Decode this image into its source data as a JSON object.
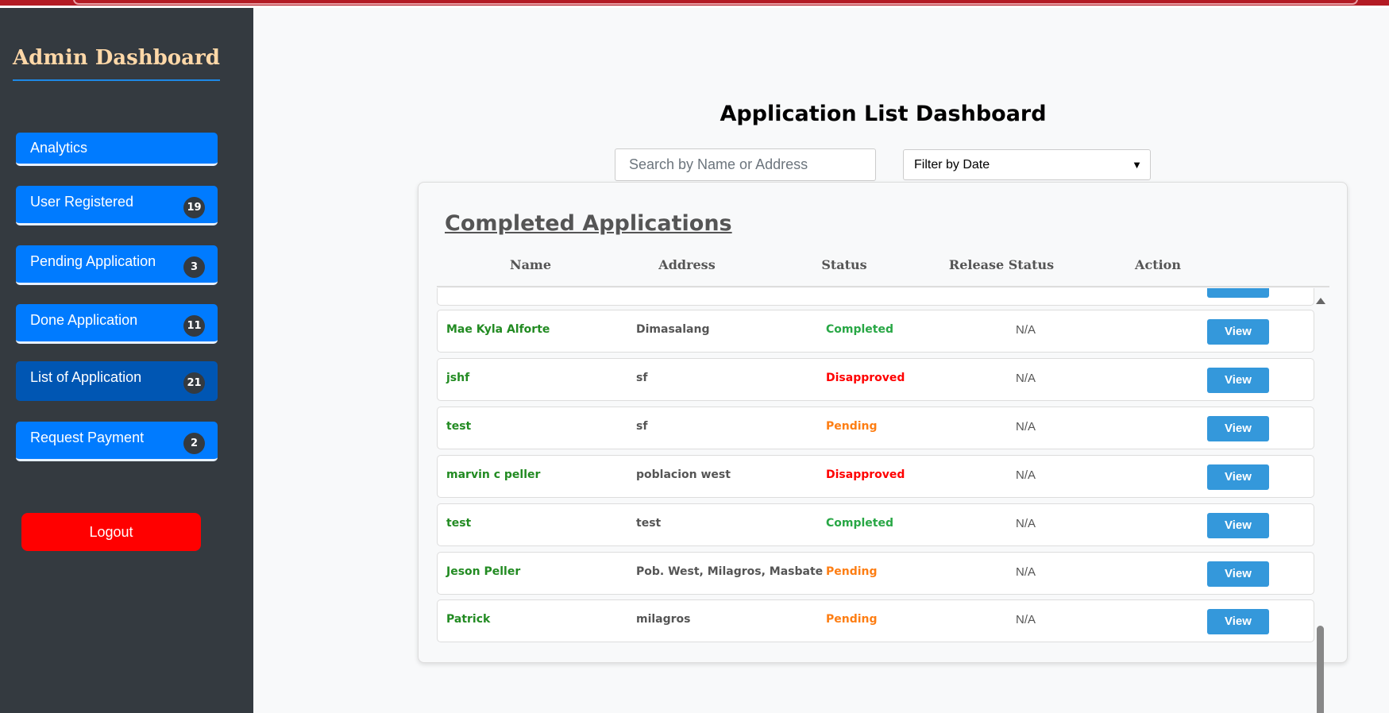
{
  "sidebar": {
    "brand": "Admin Dashboard",
    "items": [
      {
        "label": "Analytics",
        "badge": null
      },
      {
        "label": "User Registered",
        "badge": "19"
      },
      {
        "label": "Pending Application",
        "badge": "3"
      },
      {
        "label": "Done Application",
        "badge": "11"
      },
      {
        "label": "List of Application",
        "badge": "21"
      },
      {
        "label": "Request Payment",
        "badge": "2"
      }
    ],
    "logout_label": "Logout"
  },
  "main": {
    "title": "Application List Dashboard",
    "search_placeholder": "Search by Name or Address",
    "filter_selected": "Filter by Date",
    "card_title": "Completed Applications",
    "columns": [
      "Name",
      "Address",
      "Status",
      "Release Status",
      "Action"
    ],
    "rows": [
      {
        "name": "Mae Kyla Alforte",
        "address": "Dimasalang",
        "status": "Completed",
        "release": "N/A",
        "action": "View"
      },
      {
        "name": "jshf",
        "address": "sf",
        "status": "Disapproved",
        "release": "N/A",
        "action": "View"
      },
      {
        "name": "test",
        "address": "sf",
        "status": "Pending",
        "release": "N/A",
        "action": "View"
      },
      {
        "name": "marvin c peller",
        "address": "poblacion west",
        "status": "Disapproved",
        "release": "N/A",
        "action": "View"
      },
      {
        "name": "test",
        "address": "test",
        "status": "Completed",
        "release": "N/A",
        "action": "View"
      },
      {
        "name": "Jeson Peller",
        "address": "Pob. West, Milagros, Masbate",
        "status": "Pending",
        "release": "N/A",
        "action": "View"
      },
      {
        "name": "Patrick",
        "address": "milagros",
        "status": "Pending",
        "release": "N/A",
        "action": "View"
      }
    ]
  },
  "colors": {
    "sidebar_bg": "#343a40",
    "nav_blue": "#007bff",
    "nav_active": "#0056b3",
    "logout_red": "#ff0000",
    "view_button": "#3498db",
    "completed": "#28a745",
    "disapproved": "#ff0000",
    "pending": "#fd7e14",
    "name_green": "#228b22"
  }
}
